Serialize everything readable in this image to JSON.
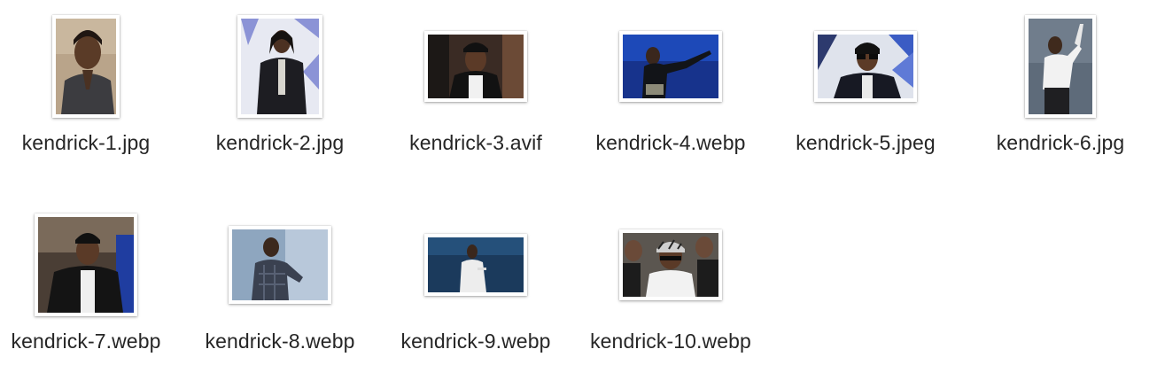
{
  "files": [
    {
      "name": "kendrick-1.jpg",
      "thumb_icon": "portrait-photo-icon"
    },
    {
      "name": "kendrick-2.jpg",
      "thumb_icon": "portrait-photo-icon"
    },
    {
      "name": "kendrick-3.avif",
      "thumb_icon": "landscape-photo-icon"
    },
    {
      "name": "kendrick-4.webp",
      "thumb_icon": "landscape-photo-icon"
    },
    {
      "name": "kendrick-5.jpeg",
      "thumb_icon": "landscape-photo-icon"
    },
    {
      "name": "kendrick-6.jpg",
      "thumb_icon": "portrait-photo-icon"
    },
    {
      "name": "kendrick-7.webp",
      "thumb_icon": "landscape-photo-icon"
    },
    {
      "name": "kendrick-8.webp",
      "thumb_icon": "landscape-photo-icon"
    },
    {
      "name": "kendrick-9.webp",
      "thumb_icon": "landscape-photo-icon"
    },
    {
      "name": "kendrick-10.webp",
      "thumb_icon": "landscape-photo-icon"
    }
  ]
}
